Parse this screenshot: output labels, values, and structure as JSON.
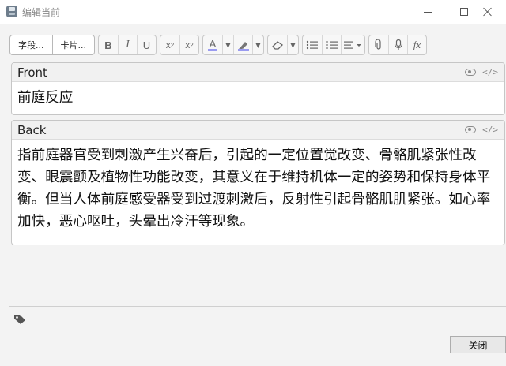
{
  "window": {
    "title": "编辑当前",
    "controls": [
      "minimize",
      "maximize",
      "close"
    ]
  },
  "toolbar": {
    "fields_button": "字段...",
    "cards_button": "卡片...",
    "bold": "B",
    "italic": "I",
    "underline": "U",
    "superscript": "x",
    "superscript_mark": "2",
    "subscript": "x",
    "subscript_mark": "2",
    "text_color_label": "A",
    "text_color": "#9a9bf0",
    "highlight_color": "#9a9bf0",
    "formula_label": "fx"
  },
  "fields": [
    {
      "name": "Front",
      "content": "前庭反应"
    },
    {
      "name": "Back",
      "content": "指前庭器官受到刺激产生兴奋后，引起的一定位置觉改变、骨骼肌紧张性改变、眼震颤及植物性功能改变，其意义在于维持机体一定的姿势和保持身体平衡。但当人体前庭感受器受到过渡刺激后，反射性引起骨骼肌肌紧张。如心率加快，恶心呕吐，头晕出冷汗等现象。"
    }
  ],
  "footer": {
    "close_label": "关闭"
  }
}
